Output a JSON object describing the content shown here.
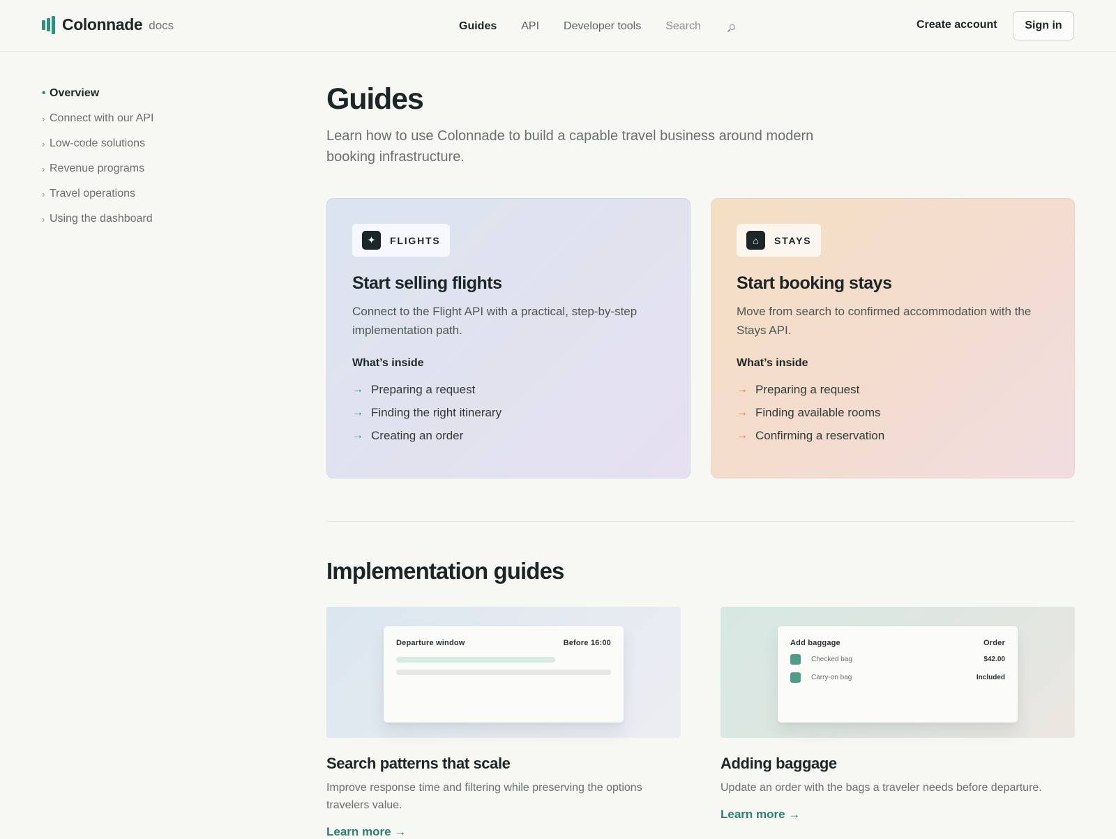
{
  "header": {
    "brand": "Colonnade",
    "brand_suffix": "docs",
    "nav": [
      {
        "label": "Guides",
        "active": true
      },
      {
        "label": "API",
        "active": false
      },
      {
        "label": "Developer tools",
        "active": false
      }
    ],
    "search_label": "Search",
    "create_account": "Create account",
    "sign_in": "Sign in"
  },
  "sidebar": {
    "items": [
      {
        "label": "Overview",
        "active": true
      },
      {
        "label": "Connect with our API",
        "active": false
      },
      {
        "label": "Low-code solutions",
        "active": false
      },
      {
        "label": "Revenue programs",
        "active": false
      },
      {
        "label": "Travel operations",
        "active": false
      },
      {
        "label": "Using the dashboard",
        "active": false
      }
    ]
  },
  "main": {
    "title": "Guides",
    "lede": "Learn how to use Colonnade to build a capable travel business around modern booking infrastructure.",
    "cards": [
      {
        "tag": "FLIGHTS",
        "icon": "sparkle-icon",
        "title": "Start selling flights",
        "description": "Connect to the Flight API with a practical, step-by-step implementation path.",
        "inside_heading": "What’s inside",
        "items": [
          "Preparing a request",
          "Finding the right itinerary",
          "Creating an order"
        ]
      },
      {
        "tag": "STAYS",
        "icon": "house-icon",
        "title": "Start booking stays",
        "description": "Move from search to confirmed accommodation with the Stays API.",
        "inside_heading": "What’s inside",
        "items": [
          "Preparing a request",
          "Finding available rooms",
          "Confirming a reservation"
        ]
      }
    ],
    "section_title": "Implementation guides",
    "guides": [
      {
        "mock": {
          "left": "Departure window",
          "right": "Before 16:00"
        },
        "title": "Search patterns that scale",
        "description": "Improve response time and filtering while preserving the options travelers value.",
        "link": "Learn more →"
      },
      {
        "mock": {
          "left": "Add baggage",
          "right": "Order",
          "rows": [
            {
              "name": "Checked bag",
              "value": "$42.00"
            },
            {
              "name": "Carry-on bag",
              "value": "Included"
            }
          ]
        },
        "title": "Adding baggage",
        "description": "Update an order with the bags a traveler needs before departure.",
        "link": "Learn more →"
      }
    ]
  },
  "colors": {
    "accent": "#2f8f7d",
    "stays_accent": "#e46f52",
    "link": "#2b7f70",
    "text": "#1d2627"
  }
}
